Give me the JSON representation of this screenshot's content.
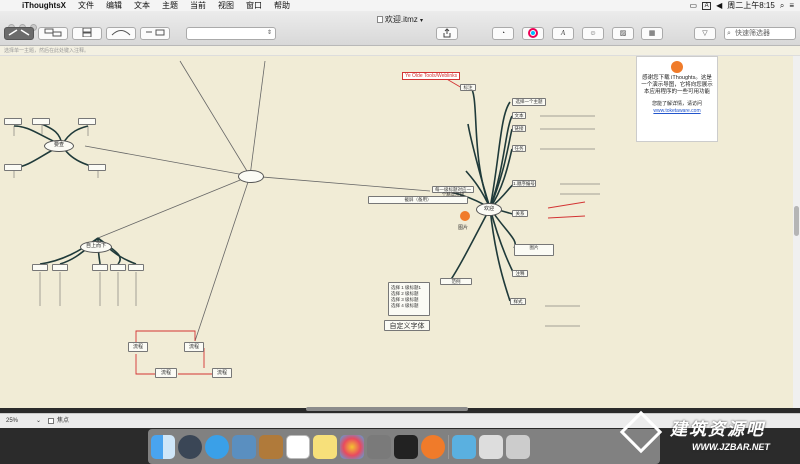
{
  "menubar": {
    "app_name": "iThoughtsX",
    "items": [
      "文件",
      "编辑",
      "文本",
      "主题",
      "当前",
      "视图",
      "窗口",
      "帮助"
    ],
    "input_indicator": "A",
    "clock": "周二上午8:15"
  },
  "window": {
    "title": "欢迎.itmz"
  },
  "toolbar": {
    "style_placeholder": "",
    "search_placeholder": "快速筛选器"
  },
  "notes_hint": "选择单一主题，然后在此处键入注释。",
  "mindmap": {
    "central": "欢迎",
    "top_topic": "标注",
    "ulr_label": "Ye Olde Tools/Weblinks",
    "topic_section": "每一级标题对应一个精度层级",
    "info_box": {
      "text": "感谢您下载 iThoughts。这是一个演示导图，它将向您展示本应用程序的一些可用功能",
      "sub": "您能了解详情，请访问",
      "link": "www.toketaware.com"
    },
    "right_topics": [
      "选择一个主题",
      "文本",
      "链接",
      "任务",
      "1.顺序编号",
      "关系",
      "图片",
      "注释",
      "样式"
    ],
    "left_upper": "要查",
    "left_lower": "自上而下",
    "flow_labels": [
      "流程",
      "流程",
      "流程",
      "流程"
    ],
    "font_block": [
      "选择 1 级标题1",
      "选择 2 级标题",
      "选择 3 级标题",
      "选择 4 级标题"
    ],
    "custom_font": "自定义字体",
    "image_topic": "范例",
    "note_box": "截屏（备用）",
    "left_bottom_topic": "图片"
  },
  "status": {
    "zoom": "25%",
    "focus_label": "焦点"
  },
  "watermark": {
    "title": "建筑资源吧",
    "url": "WWW.JZBAR.NET"
  },
  "colors": {
    "canvas": "#f1ecd6",
    "branch": "#1f3a3a",
    "red": "#d33333"
  }
}
